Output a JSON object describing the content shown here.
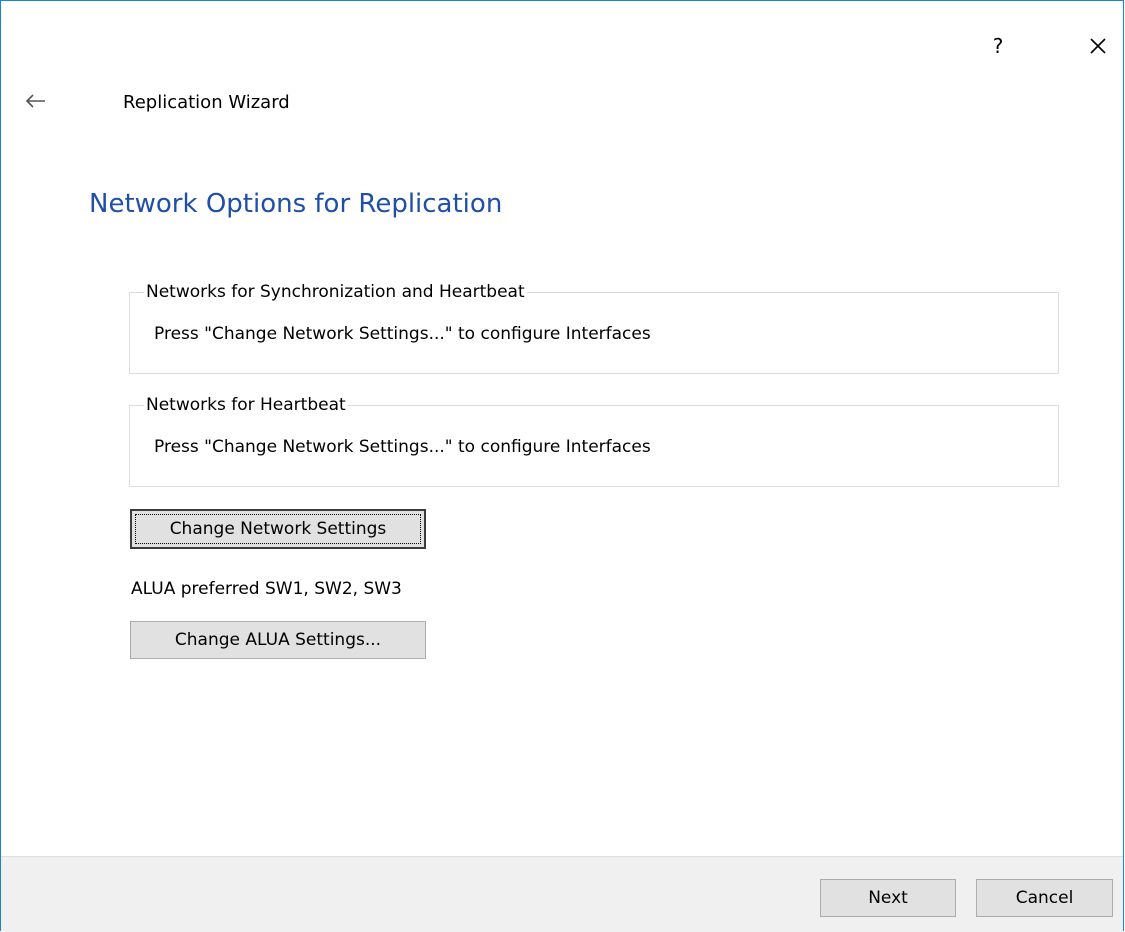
{
  "titlebar": {
    "help_label": "?",
    "close_icon": "close-icon"
  },
  "header": {
    "back_icon": "back-arrow-icon",
    "wizard_title": "Replication Wizard"
  },
  "main": {
    "page_title": "Network Options for Replication",
    "sync_group": {
      "legend": "Networks for Synchronization and Heartbeat",
      "text": "Press \"Change Network Settings...\" to configure Interfaces"
    },
    "heartbeat_group": {
      "legend": "Networks for Heartbeat",
      "text": "Press \"Change Network Settings...\" to configure Interfaces"
    },
    "change_network_label": "Change Network Settings",
    "alua_text": "ALUA preferred SW1, SW2, SW3",
    "change_alua_label": "Change ALUA Settings..."
  },
  "footer": {
    "next_label": "Next",
    "cancel_label": "Cancel"
  },
  "colors": {
    "accent": "#1883d7",
    "page_title": "#1f4fa8",
    "button_face": "#e1e1e1",
    "footer_bg": "#f0f0f0"
  }
}
